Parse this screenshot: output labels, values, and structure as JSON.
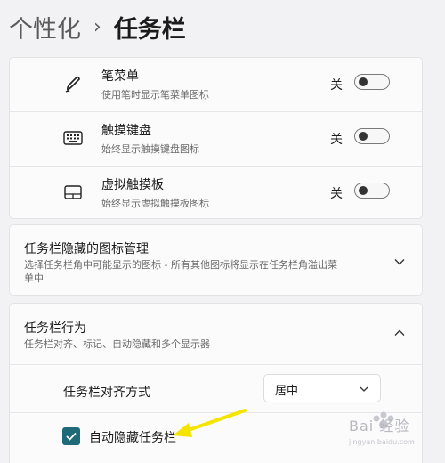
{
  "breadcrumb": {
    "parent": "个性化",
    "separator": "›",
    "current": "任务栏"
  },
  "pen_menu": {
    "title": "笔菜单",
    "subtitle": "使用笔时显示笔菜单图标",
    "toggle_label": "关",
    "icon": "pen-icon",
    "state": "off"
  },
  "touch_keyboard": {
    "title": "触摸键盘",
    "subtitle": "始终显示触摸键盘图标",
    "toggle_label": "关",
    "icon": "keyboard-icon",
    "state": "off"
  },
  "virtual_touchpad": {
    "title": "虚拟触摸板",
    "subtitle": "始终显示虚拟触摸板图标",
    "toggle_label": "关",
    "icon": "touchpad-icon",
    "state": "off"
  },
  "overflow_section": {
    "title": "任务栏隐藏的图标管理",
    "subtitle_line1": "选择任务栏角中可能显示的图标 - 所有其他图标将显示在任务栏角溢出菜",
    "subtitle_line2": "单中",
    "icon": "chevron-down-icon"
  },
  "behavior_section": {
    "title": "任务栏行为",
    "subtitle": "任务栏对齐、标记、自动隐藏和多个显示器",
    "icon": "chevron-up-icon",
    "alignment_label": "任务栏对齐方式",
    "alignment_value": "居中",
    "auto_hide_label": "自动隐藏任务栏",
    "auto_hide_checked": true
  },
  "watermark": {
    "text": "Bai 经验",
    "url": "jingyan.baidu.com"
  },
  "colors": {
    "accent": "#1f6a78",
    "annotation_arrow": "#f5e400"
  }
}
